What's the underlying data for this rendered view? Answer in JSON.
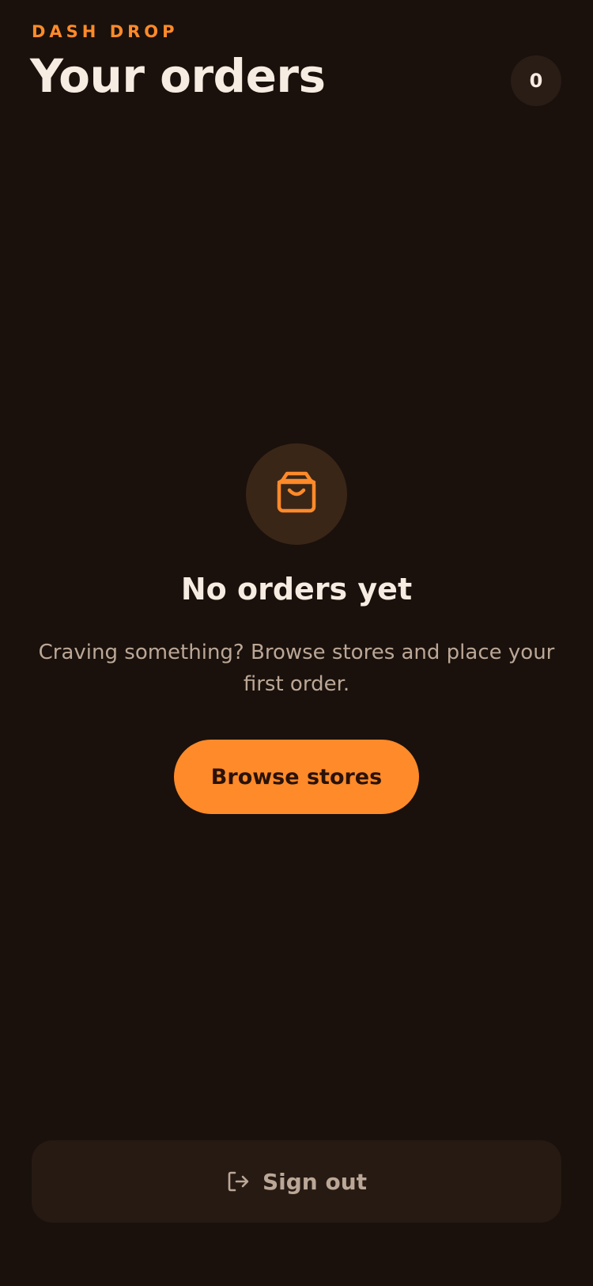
{
  "header": {
    "brand": "DASH DROP",
    "title": "Your orders",
    "order_count": "0"
  },
  "empty_state": {
    "icon": "shopping-bag-icon",
    "title": "No orders yet",
    "description": "Craving something? Browse stores and place your first order.",
    "cta_label": "Browse stores"
  },
  "footer": {
    "signout_icon": "sign-out-icon",
    "signout_label": "Sign out"
  },
  "colors": {
    "background": "#1a110c",
    "accent": "#ff8a2a",
    "text_primary": "#f7ece2",
    "text_secondary": "#bba797"
  }
}
